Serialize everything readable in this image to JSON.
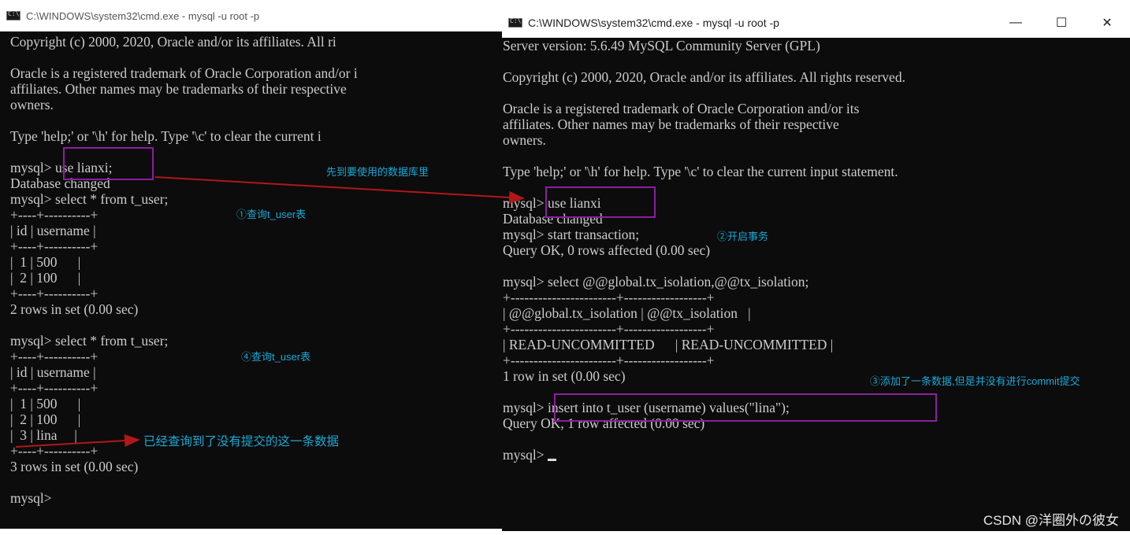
{
  "left_window": {
    "title": "C:\\WINDOWS\\system32\\cmd.exe - mysql  -u root -p",
    "lines": [
      "Copyright (c) 2000, 2020, Oracle and/or its affiliates. All ri",
      "",
      "Oracle is a registered trademark of Oracle Corporation and/or i",
      "affiliates. Other names may be trademarks of their respective",
      "owners.",
      "",
      "Type 'help;' or '\\h' for help. Type '\\c' to clear the current i",
      "",
      "mysql> use lianxi;",
      "Database changed",
      "mysql> select * from t_user;",
      "+----+----------+",
      "| id | username |",
      "+----+----------+",
      "|  1 | 500      |",
      "|  2 | 100      |",
      "+----+----------+",
      "2 rows in set (0.00 sec)",
      "",
      "mysql> select * from t_user;",
      "+----+----------+",
      "| id | username |",
      "+----+----------+",
      "|  1 | 500      |",
      "|  2 | 100      |",
      "|  3 | lina     |",
      "+----+----------+",
      "3 rows in set (0.00 sec)",
      "",
      "mysql>"
    ]
  },
  "right_window": {
    "title": "C:\\WINDOWS\\system32\\cmd.exe - mysql  -u root -p",
    "controls": {
      "minimize": "—",
      "maximize": "☐",
      "close": "✕"
    },
    "lines": [
      "Server version: 5.6.49 MySQL Community Server (GPL)",
      "",
      "Copyright (c) 2000, 2020, Oracle and/or its affiliates. All rights reserved.",
      "",
      "Oracle is a registered trademark of Oracle Corporation and/or its",
      "affiliates. Other names may be trademarks of their respective",
      "owners.",
      "",
      "Type 'help;' or '\\h' for help. Type '\\c' to clear the current input statement.",
      "",
      "mysql> use lianxi",
      "Database changed",
      "mysql> start transaction;",
      "Query OK, 0 rows affected (0.00 sec)",
      "",
      "mysql> select @@global.tx_isolation,@@tx_isolation;",
      "+-----------------------+------------------+",
      "| @@global.tx_isolation | @@tx_isolation   |",
      "+-----------------------+------------------+",
      "| READ-UNCOMMITTED      | READ-UNCOMMITTED |",
      "+-----------------------+------------------+",
      "1 row in set (0.00 sec)",
      "",
      "mysql> insert into t_user (username) values(\"lina\");",
      "Query OK, 1 row affected (0.00 sec)",
      "",
      "mysql> "
    ]
  },
  "annotations": {
    "use_db": "先到要使用的数据库里",
    "step1": "①查询t_user表",
    "step2": "②开启事务",
    "step3": "③添加了一条数据,但是并没有进行commit提交",
    "step4": "④查询t_user表",
    "found": "已经查询到了没有提交的这一条数据"
  },
  "watermark": "CSDN @洋圈外の彼女",
  "colors": {
    "terminal_bg": "#0c0c0c",
    "terminal_text": "#cccccc",
    "highlight_box": "#8b1fa0",
    "annotation": "#19a9d6",
    "arrow": "#b01818"
  }
}
